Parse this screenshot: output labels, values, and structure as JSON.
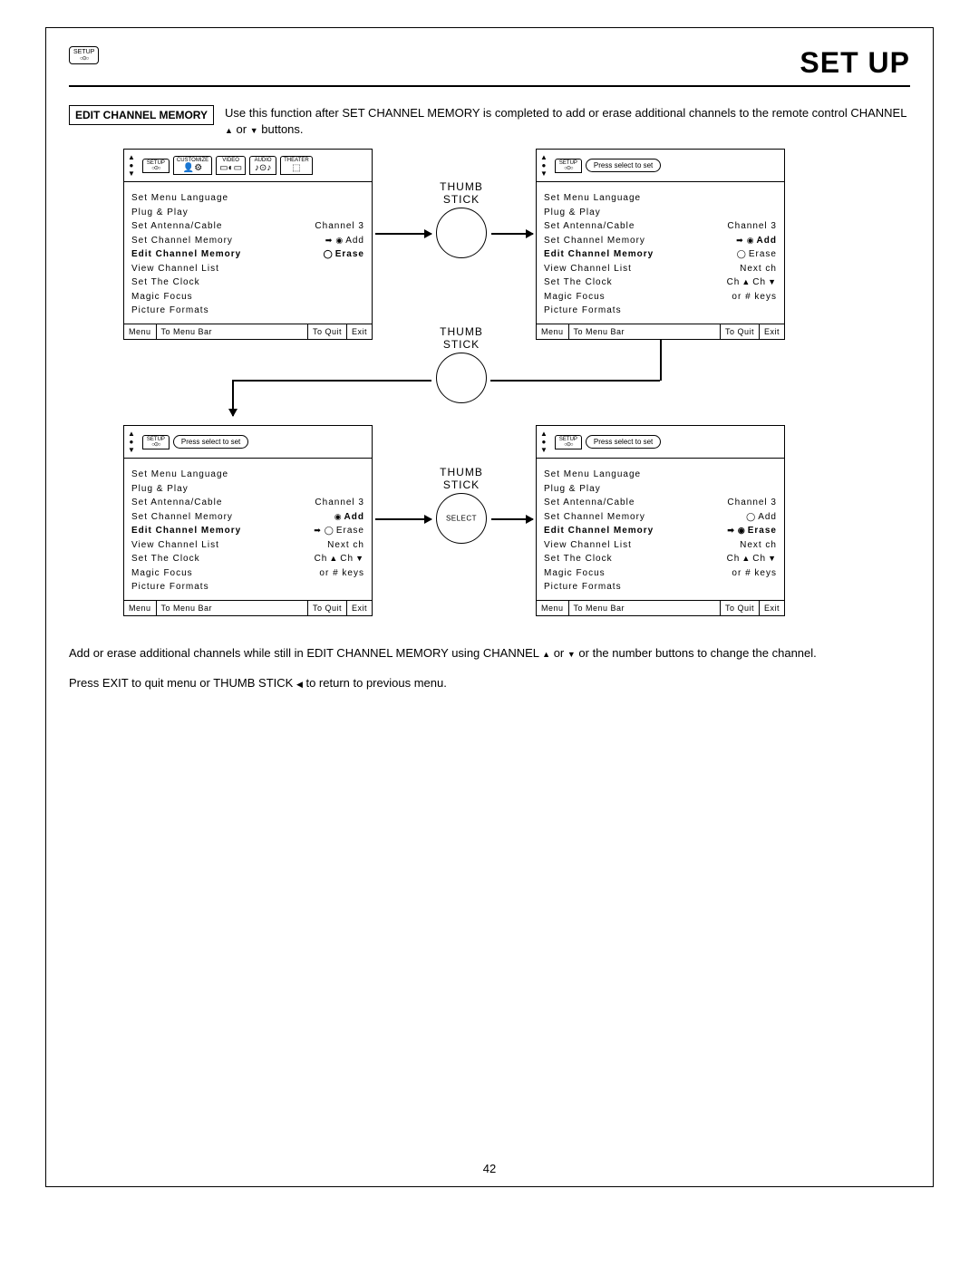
{
  "header": {
    "icon_label": "SETUP",
    "page_title": "SET UP"
  },
  "section": {
    "tag": "EDIT CHANNEL MEMORY",
    "text_a": "Use this function after SET CHANNEL MEMORY is completed to add or erase additional channels to the remote control CHANNEL ",
    "text_b": " or ",
    "text_c": " buttons."
  },
  "tabs": [
    "SETUP",
    "CUSTOMIZE",
    "VIDEO",
    "AUDIO",
    "THEATER"
  ],
  "press_select": "Press select to set",
  "menu_items": {
    "lang": "Set Menu Language",
    "plug": "Plug & Play",
    "antenna": "Set Antenna/Cable",
    "antenna_val": "Channel 3",
    "setch": "Set Channel Memory",
    "editch": "Edit Channel Memory",
    "viewch": "View Channel List",
    "clock": "Set The Clock",
    "focus": "Magic Focus",
    "formats": "Picture Formats",
    "add": "Add",
    "erase": "Erase",
    "nextch": "Next ch",
    "chupdown_a": "Ch ",
    "chupdown_b": " Ch ",
    "orkeys": "or # keys"
  },
  "footer": {
    "menu": "Menu",
    "tomb": "To Menu Bar",
    "toquit": "To Quit",
    "exit": "Exit"
  },
  "thumb_label": "THUMB",
  "stick_label": "STICK",
  "select_label": "SELECT",
  "after": {
    "p1a": "Add or erase additional channels while still in EDIT CHANNEL MEMORY using CHANNEL ",
    "p1b": " or ",
    "p1c": " or the number buttons to change the channel.",
    "p2a": "Press EXIT to quit menu or THUMB STICK ",
    "p2b": " to return to previous menu."
  },
  "page_number": "42"
}
